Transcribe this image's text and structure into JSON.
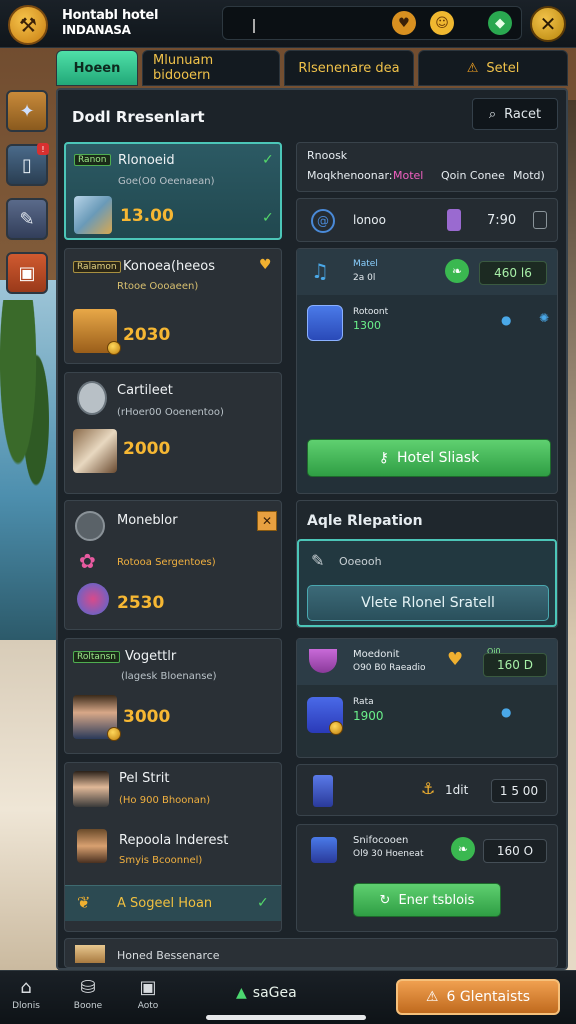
{
  "app": {
    "title_line1": "Hontabl hotel",
    "title_line2": "INDANASA"
  },
  "tabs": [
    {
      "label": "Hoeen"
    },
    {
      "label": "Mlunuam bidooern"
    },
    {
      "label": "Rlsenenare dea"
    },
    {
      "label": "Setel"
    }
  ],
  "panel": {
    "title": "Dodl Rresenlart",
    "recent_button": "Racet"
  },
  "left_cards": [
    {
      "tag": "Ranon",
      "title": "Rlonoeid",
      "subtitle": "Goe(O0 Oeenaean)",
      "price": "13.00"
    },
    {
      "tag": "Ralamon",
      "title": "Konoea(heeos",
      "subtitle": "Rtooe Oooaeen)",
      "price": "2030"
    },
    {
      "title": "Cartileet",
      "subtitle": "(rHoer00 Ooenentoo)",
      "price": "2000"
    },
    {
      "title": "Moneblor",
      "subtitle": "Rotooa Sergentoes)",
      "price": "2530"
    },
    {
      "tag": "Roltansn",
      "title": "Vogettlr",
      "subtitle": "(lagesk Bloenanse)",
      "price": "3000"
    },
    {
      "title": "Pel Strit",
      "subtitle": "(Ho 900 Bhoonan)",
      "title2": "Repoola lnderest",
      "subtitle2": "Smyis Bcoonnel)",
      "action": "A Sogeel Hoan"
    },
    {
      "title": "Honed Bessenarce"
    }
  ],
  "right": {
    "filter": {
      "label": "Rnoosk",
      "options_label": "Moqkhenoonar:",
      "opt1": "Motel",
      "opt2": "Qoin Conee",
      "opt3": "Motd)"
    },
    "row1": {
      "label": "lonoo",
      "value": "7:90"
    },
    "row2": {
      "tag": "Matel",
      "sub": "2a 0l",
      "value": "460 l6"
    },
    "row3": {
      "title": "Rotoont",
      "value": "1300"
    },
    "action1": "Hotel Sliask",
    "section_title": "Aqle Rlepation",
    "input_label": "Ooeooh",
    "action2": "Vlete Rlonel Sratell",
    "row4": {
      "title": "Moedonit",
      "sub": "O90 B0 Raeadio",
      "tag": "Oi0",
      "value": "160 D"
    },
    "row5": {
      "title": "Rata",
      "value": "1900"
    },
    "row6": {
      "label": "1dit",
      "value": "1 5 00"
    },
    "row7": {
      "title": "Snifocooen",
      "sub": "Ol9 30 Hoeneat",
      "value": "160 O"
    },
    "action3": "Ener tsblois"
  },
  "bottom": {
    "nav": [
      {
        "label": "Dlonis"
      },
      {
        "label": "Boone"
      },
      {
        "label": "Aoto"
      }
    ],
    "center_label": "saGea",
    "right_button": "6 Glentaists"
  }
}
